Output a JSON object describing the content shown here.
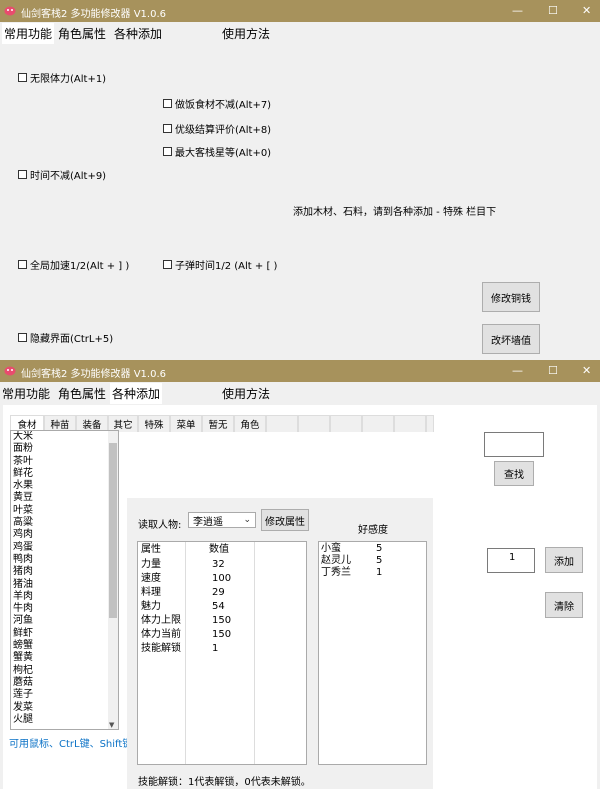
{
  "window1": {
    "title": "仙剑客栈2 多功能修改器 V1.0.6",
    "menu": [
      "常用功能",
      "角色属性",
      "各种添加",
      "使用方法"
    ],
    "checkboxes": [
      "无限体力(Alt+1)",
      "做饭食材不减(Alt+7)",
      "优级结算评价(Alt+8)",
      "最大客栈星等(Alt+0)",
      "时间不减(Alt+9)",
      "全局加速1/2(Alt + ] )",
      "子弹时间1/2 (Alt + [ )",
      "隐藏界面(CtrL+5)"
    ],
    "note": "添加木材、石料，请到各种添加 - 特殊 栏目下",
    "buttons": [
      "修改铜钱",
      "改坏墙值"
    ]
  },
  "window2": {
    "title": "仙剑客栈2 多功能修改器 V1.0.6",
    "menu": [
      "常用功能",
      "角色属性",
      "各种添加",
      "使用方法"
    ],
    "subtabs": [
      "食材",
      "种苗",
      "装备",
      "其它",
      "特殊",
      "菜单",
      "暂无",
      "角色"
    ],
    "ingredients": [
      "大米",
      "面粉",
      "茶叶",
      "鲜花",
      "水果",
      "黄豆",
      "叶菜",
      "高粱",
      "鸡肉",
      "鸡蛋",
      "鸭肉",
      "猪肉",
      "猪油",
      "羊肉",
      "牛肉",
      "河鱼",
      "鲜虾",
      "螃蟹",
      "蟹黄",
      "枸杞",
      "蘑菇",
      "莲子",
      "发菜",
      "火腿"
    ],
    "hint": "可用鼠标、CtrL键、Shift键多",
    "search_button": "查找",
    "read_label": "读取人物:",
    "character": "李逍遥",
    "modify_button": "修改属性",
    "favor_label": "好感度",
    "attr_headers": [
      "属性",
      "数值"
    ],
    "attributes": [
      {
        "name": "力量",
        "value": "32"
      },
      {
        "name": "速度",
        "value": "100"
      },
      {
        "name": "料理",
        "value": "29"
      },
      {
        "name": "魅力",
        "value": "54"
      },
      {
        "name": "体力上限",
        "value": "150"
      },
      {
        "name": "体力当前",
        "value": "150"
      },
      {
        "name": "技能解锁",
        "value": "1"
      }
    ],
    "favor": [
      {
        "name": "小蛮",
        "value": "5"
      },
      {
        "name": "赵灵儿",
        "value": "5"
      },
      {
        "name": "丁秀兰",
        "value": "1"
      }
    ],
    "quantity": "1",
    "add_button": "添加",
    "clear_button": "清除",
    "skill_note": "技能解锁：1代表解锁，0代表未解锁。"
  },
  "colors": {
    "titlebar": "#a7925c",
    "window_bg": "#f0f0f0",
    "hint_link": "#0b72c6"
  }
}
